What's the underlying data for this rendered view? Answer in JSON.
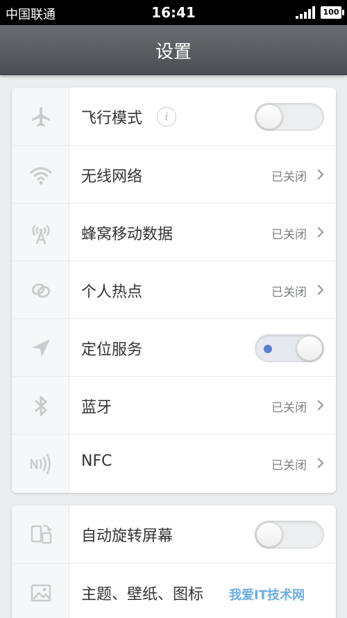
{
  "status_bar": {
    "carrier": "中国联通",
    "time": "16:41",
    "battery": "100"
  },
  "header": {
    "title": "设置"
  },
  "settings": [
    {
      "label": "飞行模式",
      "icon": "airplane-icon",
      "control": "toggle",
      "state": "off",
      "info": "i"
    },
    {
      "label": "无线网络",
      "icon": "wifi-icon",
      "control": "status",
      "status": "已关闭"
    },
    {
      "label": "蜂窝移动数据",
      "icon": "cellular-antenna-icon",
      "control": "status",
      "status": "已关闭"
    },
    {
      "label": "个人热点",
      "icon": "hotspot-link-icon",
      "control": "status",
      "status": "已关闭"
    },
    {
      "label": "定位服务",
      "icon": "location-arrow-icon",
      "control": "toggle",
      "state": "on"
    },
    {
      "label": "蓝牙",
      "icon": "bluetooth-icon",
      "control": "status",
      "status": "已关闭"
    },
    {
      "label": "NFC",
      "icon": "nfc-icon",
      "control": "status",
      "status": "已关闭"
    }
  ],
  "settings_2": [
    {
      "label": "自动旋转屏幕",
      "icon": "rotate-screen-icon",
      "control": "toggle",
      "state": "off"
    },
    {
      "label": "主题、壁纸、图标",
      "icon": "image-icon",
      "control": "status",
      "status": ""
    }
  ],
  "watermark": "我爱IT技术网",
  "colors": {
    "header_bg": "#555a5e",
    "toggle_dot": "#5a7fd0",
    "status_text": "#7d8083"
  }
}
